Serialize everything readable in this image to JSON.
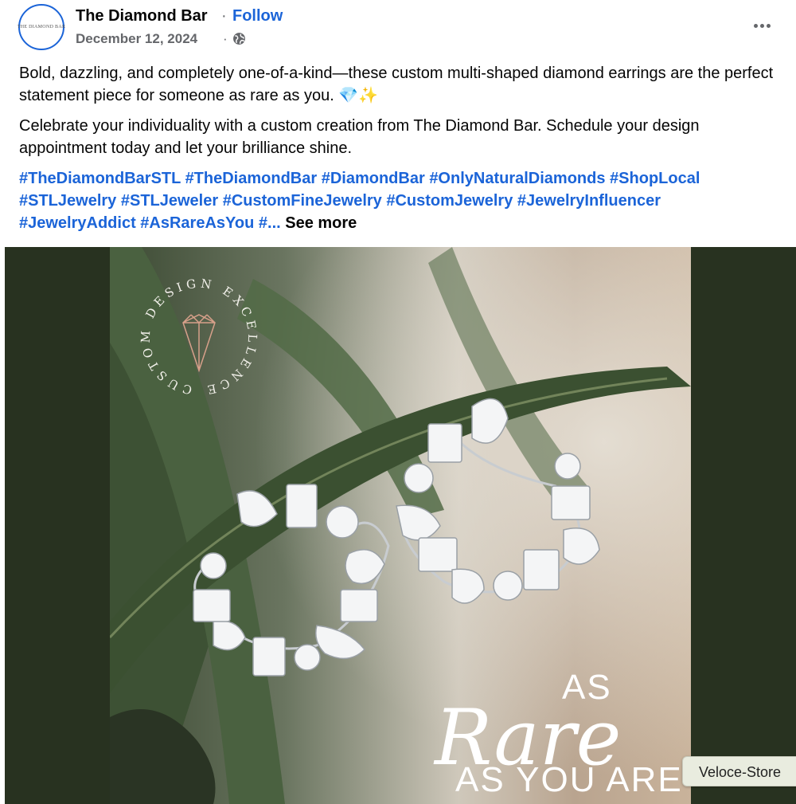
{
  "header": {
    "page_name": "The Diamond Bar",
    "separator": "·",
    "follow_label": "Follow",
    "date": "December 12, 2024",
    "date_separator": "·",
    "avatar_text": "THE DIAMOND BAR",
    "privacy_icon": "globe-icon",
    "more_icon": "more-horizontal-icon"
  },
  "post": {
    "paragraph1": "Bold, dazzling, and completely one-of-a-kind—these custom multi-shaped diamond earrings are the perfect statement piece for someone as rare as you. 💎✨",
    "paragraph2": "Celebrate your individuality with a custom creation from The Diamond Bar. Schedule your design appointment today and let your brilliance shine.",
    "hashtags": [
      "#TheDiamondBarSTL",
      "#TheDiamondBar",
      "#DiamondBar",
      "#OnlyNaturalDiamonds",
      "#ShopLocal",
      "#STLJewelry",
      "#STLJeweler",
      "#CustomFineJewelry",
      "#CustomJewelry",
      "#JewelryInfluencer",
      "#JewelryAddict",
      "#AsRareAsYou",
      "#..."
    ],
    "see_more_label": "See more"
  },
  "image": {
    "badge_text": "CUSTOM DESIGN EXCELLENCE",
    "overlay_as": "AS",
    "overlay_rare": "Rare",
    "overlay_you": "AS YOU ARE"
  },
  "tooltip": {
    "text": "Veloce-Store"
  },
  "colors": {
    "link_blue": "#1b64d8",
    "media_background": "#283220",
    "muted_gray": "#65676b"
  }
}
